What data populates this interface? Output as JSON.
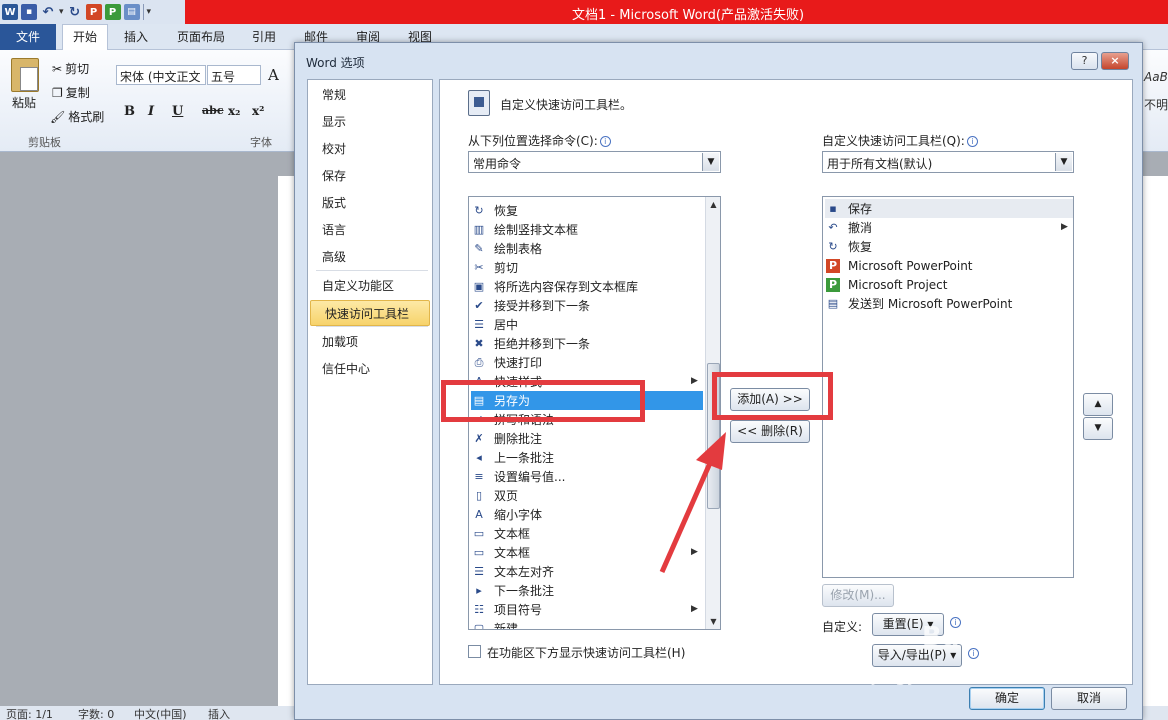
{
  "colors": {
    "titlebar": "#e81a1a",
    "selection": "#3296e8",
    "highlight": "#e33b3f",
    "nav_selected": "#f7d36b"
  },
  "word": {
    "title": "文档1 - Microsoft Word(产品激活失败)",
    "qat_icons": [
      "word-icon",
      "save-icon",
      "undo-icon",
      "redo-icon",
      "powerpoint-icon",
      "project-icon",
      "send-to-icon"
    ],
    "qat_letters": {
      "word": "W",
      "ppt": "P",
      "project": "P"
    },
    "tabs": [
      "文件",
      "开始",
      "插入",
      "页面布局",
      "引用",
      "邮件",
      "审阅",
      "视图"
    ],
    "clipboard": {
      "paste": "粘贴",
      "cut": "剪切",
      "copy": "复制",
      "format_painter": "格式刷",
      "group": "剪贴板"
    },
    "font": {
      "name": "宋体 (中文正文",
      "size": "五号",
      "group": "字体",
      "bold": "B",
      "italic": "I",
      "underline": "U",
      "strike": "abc",
      "sub": "x₂",
      "sup": "x²",
      "grow": "A"
    },
    "ribbon_right": {
      "style_preview": "AaBb",
      "no_spacing": "不明"
    },
    "status": {
      "page": "页面: 1/1",
      "words": "字数: 0",
      "lang": "中文(中国)",
      "insert": "插入"
    }
  },
  "dialog": {
    "title": "Word 选项",
    "help": "?",
    "close": "×",
    "nav": [
      "常规",
      "显示",
      "校对",
      "保存",
      "版式",
      "语言",
      "高级",
      "自定义功能区",
      "快速访问工具栏",
      "加载项",
      "信任中心"
    ],
    "header": "自定义快速访问工具栏。",
    "left_label": "从下列位置选择命令(C):",
    "left_combo": "常用命令",
    "right_label": "自定义快速访问工具栏(Q):",
    "right_combo": "用于所有文档(默认)",
    "commands": [
      {
        "label": "恢复",
        "icon": "redo-icon",
        "glyph": "↻"
      },
      {
        "label": "绘制竖排文本框",
        "icon": "vertical-textbox-icon",
        "glyph": "▥"
      },
      {
        "label": "绘制表格",
        "icon": "draw-table-icon",
        "glyph": "✎"
      },
      {
        "label": "剪切",
        "icon": "cut-icon",
        "glyph": "✂"
      },
      {
        "label": "将所选内容保存到文本框库",
        "icon": "textbox-gallery-icon",
        "glyph": "▣"
      },
      {
        "label": "接受并移到下一条",
        "icon": "accept-change-icon",
        "glyph": "✔"
      },
      {
        "label": "居中",
        "icon": "align-center-icon",
        "glyph": "☰"
      },
      {
        "label": "拒绝并移到下一条",
        "icon": "reject-change-icon",
        "glyph": "✖"
      },
      {
        "label": "快速打印",
        "icon": "quick-print-icon",
        "glyph": "⎙"
      },
      {
        "label": "快速样式",
        "icon": "quick-styles-icon",
        "glyph": "A"
      },
      {
        "label": "另存为",
        "icon": "save-as-icon",
        "glyph": "▤"
      },
      {
        "label": "拼写和语法",
        "icon": "spelling-icon",
        "glyph": "✓"
      },
      {
        "label": "删除批注",
        "icon": "delete-comment-icon",
        "glyph": "✗"
      },
      {
        "label": "上一条批注",
        "icon": "previous-comment-icon",
        "glyph": "◂"
      },
      {
        "label": "设置编号值...",
        "icon": "numbering-value-icon",
        "glyph": "≡"
      },
      {
        "label": "双页",
        "icon": "two-pages-icon",
        "glyph": "▯"
      },
      {
        "label": "缩小字体",
        "icon": "shrink-font-icon",
        "glyph": "A"
      },
      {
        "label": "文本框",
        "icon": "textbox-icon",
        "glyph": "▭"
      },
      {
        "label": "文本框",
        "icon": "textbox-menu-icon",
        "glyph": "▭"
      },
      {
        "label": "文本左对齐",
        "icon": "align-left-icon",
        "glyph": "☰"
      },
      {
        "label": "下一条批注",
        "icon": "next-comment-icon",
        "glyph": "▸"
      },
      {
        "label": "项目符号",
        "icon": "bullets-icon",
        "glyph": "☷"
      },
      {
        "label": "新建",
        "icon": "new-icon",
        "glyph": "▢"
      }
    ],
    "toolbar_items": [
      {
        "label": "保存",
        "icon": "save-icon",
        "glyph": "▪"
      },
      {
        "label": "撤消",
        "icon": "undo-icon",
        "glyph": "↶"
      },
      {
        "label": "恢复",
        "icon": "redo-icon",
        "glyph": "↻"
      },
      {
        "label": "Microsoft PowerPoint",
        "icon": "powerpoint-icon",
        "glyph": "P"
      },
      {
        "label": "Microsoft Project",
        "icon": "project-icon",
        "glyph": "P"
      },
      {
        "label": "发送到 Microsoft PowerPoint",
        "icon": "send-to-powerpoint-icon",
        "glyph": "▤"
      }
    ],
    "add_button": "添加(A) >>",
    "remove_button": "<< 删除(R)",
    "modify_button": "修改(M)...",
    "customize_label": "自定义:",
    "reset_button": "重置(E) ▾",
    "import_export_button": "导入/导出(P) ▾",
    "show_below_ribbon": "在功能区下方显示快速访问工具栏(H)",
    "ok": "确定",
    "cancel": "取消"
  },
  "watermark": {
    "brand": "Baidu 经验",
    "url": "jingyan.baidu.com"
  }
}
